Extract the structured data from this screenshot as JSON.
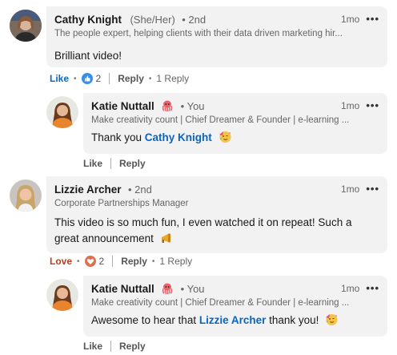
{
  "comments": [
    {
      "name": "Cathy Knight",
      "pronouns": "(She/Her)",
      "degree": "• 2nd",
      "time": "1mo",
      "headline": "The people expert, helping clients with their data driven marketing hir...",
      "text": "Brilliant video!",
      "react_label": "Like",
      "react_count": "2",
      "reply_label": "Reply",
      "replies_label": "1 Reply",
      "react_color": "#0a66c2"
    },
    {
      "name": "Katie Nuttall",
      "degree": "• You",
      "time": "1mo",
      "headline": "Make creativity count | Chief Dreamer & Founder | e-learning ...",
      "text_before": "Thank you ",
      "mention": "Cathy Knight",
      "text_after": "",
      "like_label": "Like",
      "reply_label": "Reply"
    },
    {
      "name": "Lizzie Archer",
      "degree": "• 2nd",
      "time": "1mo",
      "headline": "Corporate Partnerships Manager",
      "text": "This video is so much fun, I even watched it on repeat! Such a great announcement",
      "react_label": "Love",
      "react_count": "2",
      "reply_label": "Reply",
      "replies_label": "1 Reply",
      "react_color": "#b24020"
    },
    {
      "name": "Katie Nuttall",
      "degree": "• You",
      "time": "1mo",
      "headline": "Make creativity count | Chief Dreamer & Founder | e-learning ...",
      "text_before": "Awesome to hear that ",
      "mention": "Lizzie Archer",
      "text_after": " thank you!",
      "like_label": "Like",
      "reply_label": "Reply"
    }
  ],
  "icons": {
    "more": "more-options-icon",
    "octopus": "octopus-emoji",
    "party": "partying-face-emoji",
    "megaphone": "megaphone-emoji",
    "like": "like-thumb-icon",
    "love": "love-heart-icon"
  }
}
